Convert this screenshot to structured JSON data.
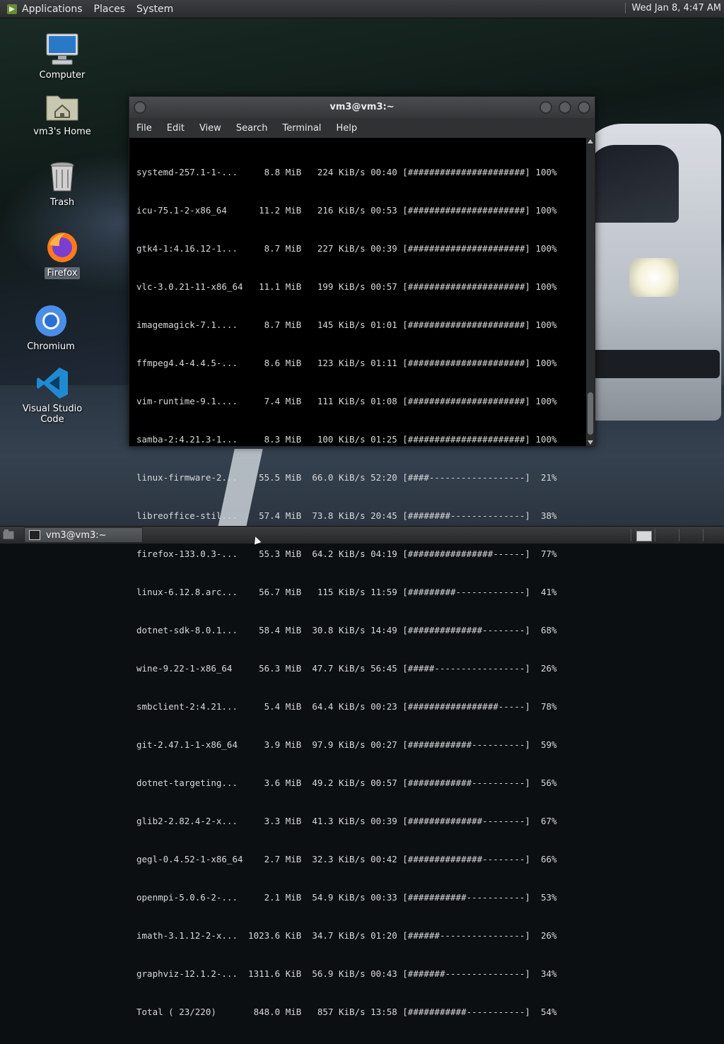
{
  "top_panel": {
    "menus": [
      "Applications",
      "Places",
      "System"
    ],
    "clock": "Wed Jan  8,  4:47 AM"
  },
  "desktop_icons": [
    {
      "label": "Computer",
      "icon": "computer-icon"
    },
    {
      "label": "vm3's Home",
      "icon": "home-folder-icon"
    },
    {
      "label": "Trash",
      "icon": "trash-icon"
    },
    {
      "label": "Firefox",
      "icon": "firefox-icon",
      "selected": true
    },
    {
      "label": "Chromium",
      "icon": "chromium-icon"
    },
    {
      "label": "Visual Studio Code",
      "icon": "vscode-icon"
    }
  ],
  "terminal": {
    "title": "vm3@vm3:~",
    "menu": [
      "File",
      "Edit",
      "View",
      "Search",
      "Terminal",
      "Help"
    ],
    "lines": [
      "systemd-257.1-1-...     8.8 MiB   224 KiB/s 00:40 [######################] 100%",
      "icu-75.1-2-x86_64      11.2 MiB   216 KiB/s 00:53 [######################] 100%",
      "gtk4-1:4.16.12-1...     8.7 MiB   227 KiB/s 00:39 [######################] 100%",
      "vlc-3.0.21-11-x86_64   11.1 MiB   199 KiB/s 00:57 [######################] 100%",
      "imagemagick-7.1....     8.7 MiB   145 KiB/s 01:01 [######################] 100%",
      "ffmpeg4.4-4.4.5-...     8.6 MiB   123 KiB/s 01:11 [######################] 100%",
      "vim-runtime-9.1....     7.4 MiB   111 KiB/s 01:08 [######################] 100%",
      "samba-2:4.21.3-1...     8.3 MiB   100 KiB/s 01:25 [######################] 100%",
      "linux-firmware-2...    55.5 MiB  66.0 KiB/s 52:20 [####------------------]  21%",
      "libreoffice-stil...    57.4 MiB  73.8 KiB/s 20:45 [########--------------]  38%",
      "firefox-133.0.3-...    55.3 MiB  64.2 KiB/s 04:19 [################------]  77%",
      "linux-6.12.8.arc...    56.7 MiB   115 KiB/s 11:59 [#########-------------]  41%",
      "dotnet-sdk-8.0.1...    58.4 MiB  30.8 KiB/s 14:49 [##############--------]  68%",
      "wine-9.22-1-x86_64     56.3 MiB  47.7 KiB/s 56:45 [#####-----------------]  26%",
      "smbclient-2:4.21...     5.4 MiB  64.4 KiB/s 00:23 [#################-----]  78%",
      "git-2.47.1-1-x86_64     3.9 MiB  97.9 KiB/s 00:27 [############----------]  59%",
      "dotnet-targeting...     3.6 MiB  49.2 KiB/s 00:57 [############----------]  56%",
      "glib2-2.82.4-2-x...     3.3 MiB  41.3 KiB/s 00:39 [##############--------]  67%",
      "gegl-0.4.52-1-x86_64    2.7 MiB  32.3 KiB/s 00:42 [##############--------]  66%",
      "openmpi-5.0.6-2-...     2.1 MiB  54.9 KiB/s 00:33 [###########-----------]  53%",
      "imath-3.1.12-2-x...  1023.6 KiB  34.7 KiB/s 01:20 [######----------------]  26%",
      "graphviz-12.1.2-...  1311.6 KiB  56.9 KiB/s 00:43 [#######---------------]  34%",
      "Total ( 23/220)       848.0 MiB   857 KiB/s 13:58 [###########-----------]  54%"
    ]
  },
  "taskbar": {
    "tasks": [
      "vm3@vm3:~"
    ]
  },
  "colors": {
    "panel": "#2f3133",
    "terminal_bg": "#000000",
    "terminal_fg": "#d8d8d8"
  }
}
